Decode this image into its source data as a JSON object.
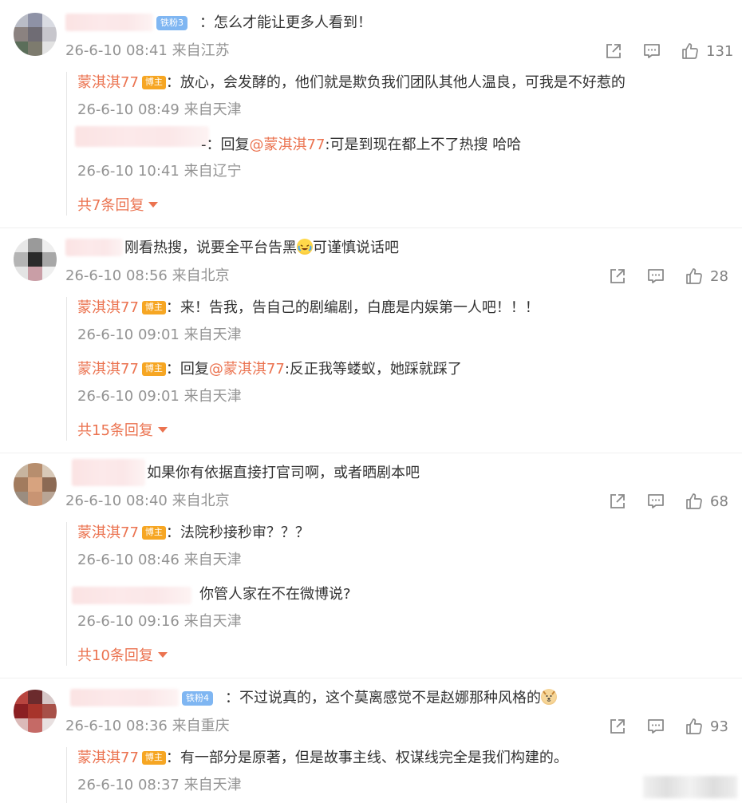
{
  "threads": [
    {
      "fan_badge": "铁粉3",
      "text": "：怎么才能让更多人看到！",
      "meta": "26-6-10 08:41 来自江苏",
      "likes": "131",
      "replies": [
        {
          "author": "蒙淇淇77",
          "badge": "博主",
          "text": "：放心，会发酵的，他们就是欺负我们团队其他人温良，可我是不好惹的",
          "meta": "26-6-10 08:49 来自天津"
        },
        {
          "author_suffix": "-：回复",
          "mention": "@蒙淇淇77",
          "text": ":可是到现在都上不了热搜 哈哈",
          "meta": "26-6-10 10:41 来自辽宁"
        }
      ],
      "reply_count": "共7条回复"
    },
    {
      "text": "刚看热搜，说要全平台告黑",
      "text_after_emoji": "可谨慎说话吧",
      "meta": "26-6-10 08:56 来自北京",
      "likes": "28",
      "replies": [
        {
          "author": "蒙淇淇77",
          "badge": "博主",
          "text": "：来！告我，告自己的剧编剧，白鹿是内娱第一人吧！！！",
          "meta": "26-6-10 09:01 来自天津"
        },
        {
          "author": "蒙淇淇77",
          "badge": "博主",
          "prefix": "：回复",
          "mention": "@蒙淇淇77",
          "text": ":反正我等蝼蚁，她踩就踩了",
          "meta": "26-6-10 09:01 来自天津"
        }
      ],
      "reply_count": "共15条回复"
    },
    {
      "text": "如果你有依据直接打官司啊，或者晒剧本吧",
      "meta": "26-6-10 08:40 来自北京",
      "likes": "68",
      "replies": [
        {
          "author": "蒙淇淇77",
          "badge": "博主",
          "text": "：法院秒接秒审？？？",
          "meta": "26-6-10 08:46 来自天津"
        },
        {
          "text": "你管人家在不在微博说?",
          "meta": "26-6-10 09:16 来自天津"
        }
      ],
      "reply_count": "共10条回复"
    },
    {
      "fan_badge": "铁粉4",
      "text": "：不过说真的，这个莫离感觉不是赵娜那种风格的",
      "meta": "26-6-10 08:36 来自重庆",
      "likes": "93",
      "replies": [
        {
          "author": "蒙淇淇77",
          "badge": "博主",
          "text": "：有一部分是原著，但是故事主线、权谋线完全是我们构建的。",
          "meta": "26-6-10 08:37 来自天津"
        }
      ]
    }
  ],
  "colors": {
    "accent": "#eb7350",
    "meta": "#939393",
    "badge": "#f6a623",
    "fan_badge": "#7fb6f2"
  },
  "icons": [
    "share-icon",
    "comment-icon",
    "thumbs-up-icon",
    "laugh-cry-emoji-icon",
    "dog-emoji-icon"
  ]
}
